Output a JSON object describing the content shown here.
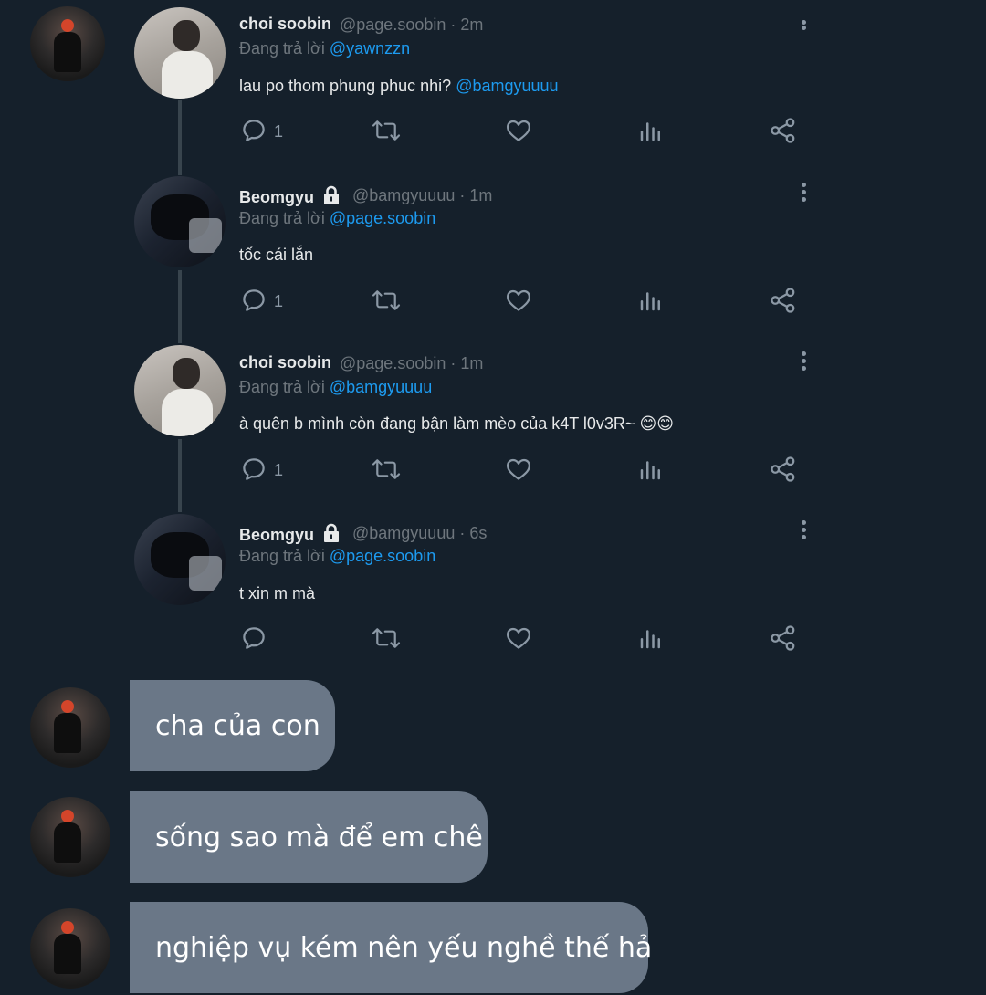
{
  "thread": {
    "tweets": [
      {
        "name": "choi soobin",
        "locked": false,
        "handle_time": "@page.soobin · 2m",
        "replying_prefix": "Đang trả lời",
        "replying_to": "@yawnzzn",
        "text": "lau po thom phung phuc nhi?",
        "text_mention": "@bamgyuuuu",
        "reply_count": "1"
      },
      {
        "name": "Beomgyu",
        "locked": true,
        "handle_time": "@bamgyuuuu · 1m",
        "replying_prefix": "Đang trả lời",
        "replying_to": "@page.soobin",
        "text": "tốc cái lắn",
        "text_mention": "",
        "reply_count": "1"
      },
      {
        "name": "choi soobin",
        "locked": false,
        "handle_time": "@page.soobin · 1m",
        "replying_prefix": "Đang trả lời",
        "replying_to": "@bamgyuuuu",
        "text": "à quên b mình còn đang bận làm mèo của k4T l0v3R~ 😊😊",
        "text_mention": "",
        "reply_count": "1"
      },
      {
        "name": "Beomgyu",
        "locked": true,
        "handle_time": "@bamgyuuuu · 6s",
        "replying_prefix": "Đang trả lời",
        "replying_to": "@page.soobin",
        "text": "t xin m mà",
        "text_mention": "",
        "reply_count": ""
      }
    ]
  },
  "messages": [
    {
      "text": "cha của con"
    },
    {
      "text": "sống sao mà để em chê"
    },
    {
      "text": "nghiệp vụ kém nên yếu nghề thế hả"
    }
  ],
  "icons": {
    "reply": "reply-icon",
    "retweet": "retweet-icon",
    "like": "heart-icon",
    "views": "bar-chart-icon",
    "share": "share-icon",
    "more": "more-vertical-icon",
    "lock": "lock-icon"
  },
  "colors": {
    "background": "#15202b",
    "link": "#1d9bf0",
    "muted": "#6e767d",
    "bubble": "#6a7787",
    "thread_line": "#38444d"
  }
}
